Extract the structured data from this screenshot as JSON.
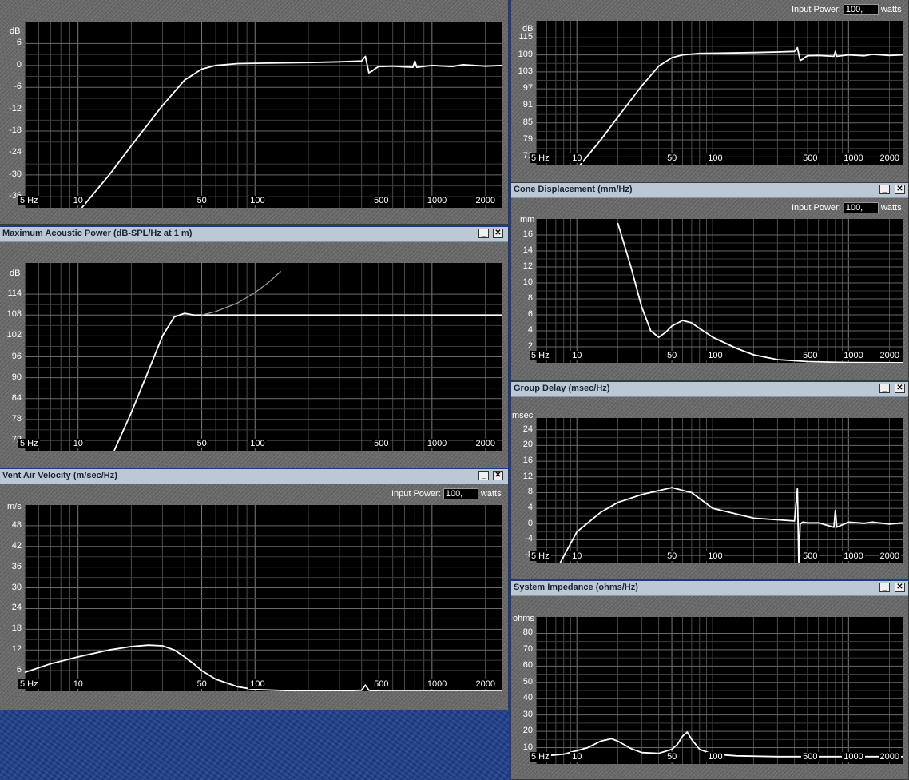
{
  "windows": {
    "response": {
      "title": "",
      "y_unit": "dB",
      "y_ticks": [
        "6",
        "0",
        "-6",
        "-12",
        "-18",
        "-24",
        "-30",
        "-36"
      ],
      "x_ticks": [
        "5 Hz",
        "10",
        "50",
        "100",
        "500",
        "1000",
        "2000"
      ]
    },
    "spl": {
      "title": "",
      "power_label": "Input Power:",
      "power_value": "100,",
      "power_unit": "watts",
      "y_unit": "dB",
      "y_ticks": [
        "115",
        "109",
        "103",
        "97",
        "91",
        "85",
        "79",
        "73"
      ],
      "x_ticks": [
        "5 Hz",
        "10",
        "50",
        "100",
        "500",
        "1000",
        "2000"
      ]
    },
    "max_power": {
      "title": "Maximum Acoustic Power (dB-SPL/Hz at 1 m)",
      "y_unit": "dB",
      "y_ticks": [
        "114",
        "108",
        "102",
        "96",
        "90",
        "84",
        "78",
        "72"
      ],
      "x_ticks": [
        "5 Hz",
        "10",
        "50",
        "100",
        "500",
        "1000",
        "2000"
      ]
    },
    "cone": {
      "title": "Cone Displacement (mm/Hz)",
      "power_label": "Input Power:",
      "power_value": "100,",
      "power_unit": "watts",
      "y_unit": "mm",
      "y_ticks": [
        "16",
        "14",
        "12",
        "10",
        "8",
        "6",
        "4",
        "2"
      ],
      "x_ticks": [
        "5 Hz",
        "10",
        "50",
        "100",
        "500",
        "1000",
        "2000"
      ]
    },
    "group_delay": {
      "title": "Group Delay (msec/Hz)",
      "y_unit": "msec",
      "y_ticks": [
        "24",
        "20",
        "16",
        "12",
        "8",
        "4",
        "0",
        "-4",
        "-8"
      ],
      "x_ticks": [
        "5 Hz",
        "10",
        "50",
        "100",
        "500",
        "1000",
        "2000"
      ]
    },
    "vent": {
      "title": "Vent Air Velocity (m/sec/Hz)",
      "power_label": "Input Power:",
      "power_value": "100,",
      "power_unit": "watts",
      "y_unit": "m/s",
      "y_ticks": [
        "48",
        "42",
        "36",
        "30",
        "24",
        "18",
        "12",
        "6"
      ],
      "x_ticks": [
        "5 Hz",
        "10",
        "50",
        "100",
        "500",
        "1000",
        "2000"
      ]
    },
    "impedance": {
      "title": "System Impedance (ohms/Hz)",
      "y_unit": "ohms",
      "y_ticks": [
        "80",
        "70",
        "60",
        "50",
        "40",
        "30",
        "20",
        "10"
      ],
      "x_ticks": [
        "5 Hz",
        "10",
        "50",
        "100",
        "500",
        "1000",
        "2000"
      ]
    }
  },
  "window_buttons": {
    "minimize": "_",
    "close": "✕"
  },
  "chart_data": [
    {
      "type": "line",
      "title": "",
      "ylabel": "dB",
      "xscale": "log",
      "xlim": [
        5,
        2500
      ],
      "ylim": [
        -39,
        12
      ],
      "series": [
        {
          "x": [
            10.5,
            15,
            20,
            30,
            40,
            50,
            60,
            80,
            100,
            200,
            300,
            400,
            420,
            440,
            460,
            480,
            500,
            600,
            780,
            800,
            820,
            1000,
            1300,
            1500,
            2000,
            2500
          ],
          "y": [
            -39,
            -30,
            -22,
            -11,
            -4,
            -1,
            0,
            0.5,
            0.6,
            0.8,
            1.0,
            1.2,
            2.5,
            -2,
            -1.5,
            -0.8,
            -0.3,
            -0.2,
            -0.5,
            1.2,
            -0.5,
            0,
            -0.3,
            0.2,
            -0.2,
            0
          ]
        }
      ]
    },
    {
      "type": "line",
      "title": "",
      "ylabel": "dB",
      "xscale": "log",
      "xlim": [
        5,
        2500
      ],
      "ylim": [
        70,
        121
      ],
      "series": [
        {
          "x": [
            10.5,
            15,
            20,
            30,
            40,
            50,
            60,
            80,
            100,
            200,
            300,
            400,
            420,
            440,
            460,
            480,
            500,
            600,
            780,
            800,
            820,
            1000,
            1300,
            1500,
            2000,
            2500
          ],
          "y": [
            70,
            79,
            87,
            98,
            105,
            108,
            109,
            109.5,
            109.6,
            109.8,
            110,
            110.2,
            111.5,
            107,
            107.5,
            108.2,
            108.7,
            108.8,
            108.5,
            110.2,
            108.5,
            109,
            108.7,
            109.2,
            108.8,
            109
          ]
        }
      ]
    },
    {
      "type": "line",
      "title": "Maximum Acoustic Power (dB-SPL/Hz at 1 m)",
      "ylabel": "dB",
      "xscale": "log",
      "xlim": [
        5,
        2500
      ],
      "ylim": [
        69,
        123
      ],
      "series": [
        {
          "x": [
            16,
            20,
            25,
            30,
            35,
            40,
            45,
            50,
            60,
            80,
            100,
            2500
          ],
          "y": [
            69,
            80,
            92,
            102,
            107.5,
            108.5,
            108,
            108,
            108,
            108,
            108,
            108
          ]
        },
        {
          "x": [
            50,
            60,
            80,
            100,
            120,
            140
          ],
          "y": [
            108,
            109,
            111.5,
            114.5,
            117.5,
            120.6
          ]
        }
      ]
    },
    {
      "type": "line",
      "title": "Cone Displacement (mm/Hz)",
      "ylabel": "mm",
      "xscale": "log",
      "xlim": [
        5,
        2500
      ],
      "ylim": [
        0,
        18
      ],
      "series": [
        {
          "x": [
            20,
            25,
            30,
            35,
            40,
            45,
            50,
            60,
            70,
            80,
            100,
            150,
            200,
            300,
            500,
            1000,
            2500
          ],
          "y": [
            17.5,
            12,
            7,
            4,
            3.2,
            3.8,
            4.6,
            5.3,
            5,
            4.3,
            3.2,
            1.8,
            1.0,
            0.4,
            0.15,
            0.04,
            0.01
          ]
        }
      ]
    },
    {
      "type": "line",
      "title": "Group Delay (msec/Hz)",
      "ylabel": "msec",
      "xscale": "log",
      "xlim": [
        5,
        2500
      ],
      "ylim": [
        -10,
        27
      ],
      "series": [
        {
          "x": [
            7.5,
            10,
            15,
            20,
            30,
            40,
            50,
            70,
            100,
            200,
            400,
            420,
            430,
            440,
            460,
            500,
            600,
            780,
            800,
            820,
            1000,
            1300,
            1500,
            2000,
            2500
          ],
          "y": [
            -10,
            -2,
            3,
            5.5,
            7.5,
            8.5,
            9.3,
            8,
            4,
            1.5,
            0.8,
            9,
            -10,
            0,
            0.5,
            0.3,
            0.3,
            -0.8,
            3.5,
            -0.8,
            0.5,
            0.2,
            0.5,
            0,
            0.3
          ]
        }
      ]
    },
    {
      "type": "line",
      "title": "Vent Air Velocity (m/sec/Hz)",
      "ylabel": "m/s",
      "xscale": "log",
      "xlim": [
        5,
        2500
      ],
      "ylim": [
        0,
        54
      ],
      "series": [
        {
          "x": [
            5,
            7,
            10,
            15,
            20,
            25,
            30,
            35,
            40,
            45,
            50,
            60,
            80,
            100,
            150,
            200,
            300,
            400,
            420,
            440,
            460,
            500,
            1000,
            2500
          ],
          "y": [
            5.5,
            8,
            10,
            12,
            13,
            13.4,
            13.2,
            12,
            10,
            8,
            6,
            3.5,
            1.3,
            0.5,
            0.2,
            0.1,
            0.05,
            0.3,
            1.8,
            0.3,
            0.1,
            0,
            0,
            0
          ]
        }
      ]
    },
    {
      "type": "line",
      "title": "System Impedance (ohms/Hz)",
      "ylabel": "ohms",
      "xscale": "log",
      "xlim": [
        5,
        2500
      ],
      "ylim": [
        0,
        90
      ],
      "series": [
        {
          "x": [
            5,
            8,
            12,
            15,
            18,
            20,
            25,
            30,
            40,
            50,
            55,
            60,
            65,
            70,
            80,
            100,
            150,
            300,
            1000,
            2500
          ],
          "y": [
            4.5,
            6,
            10,
            14,
            15.5,
            14,
            9.5,
            7,
            6.5,
            9,
            12,
            17,
            19.5,
            15,
            9,
            6,
            5,
            4.5,
            4.5,
            4.5
          ]
        }
      ]
    }
  ]
}
